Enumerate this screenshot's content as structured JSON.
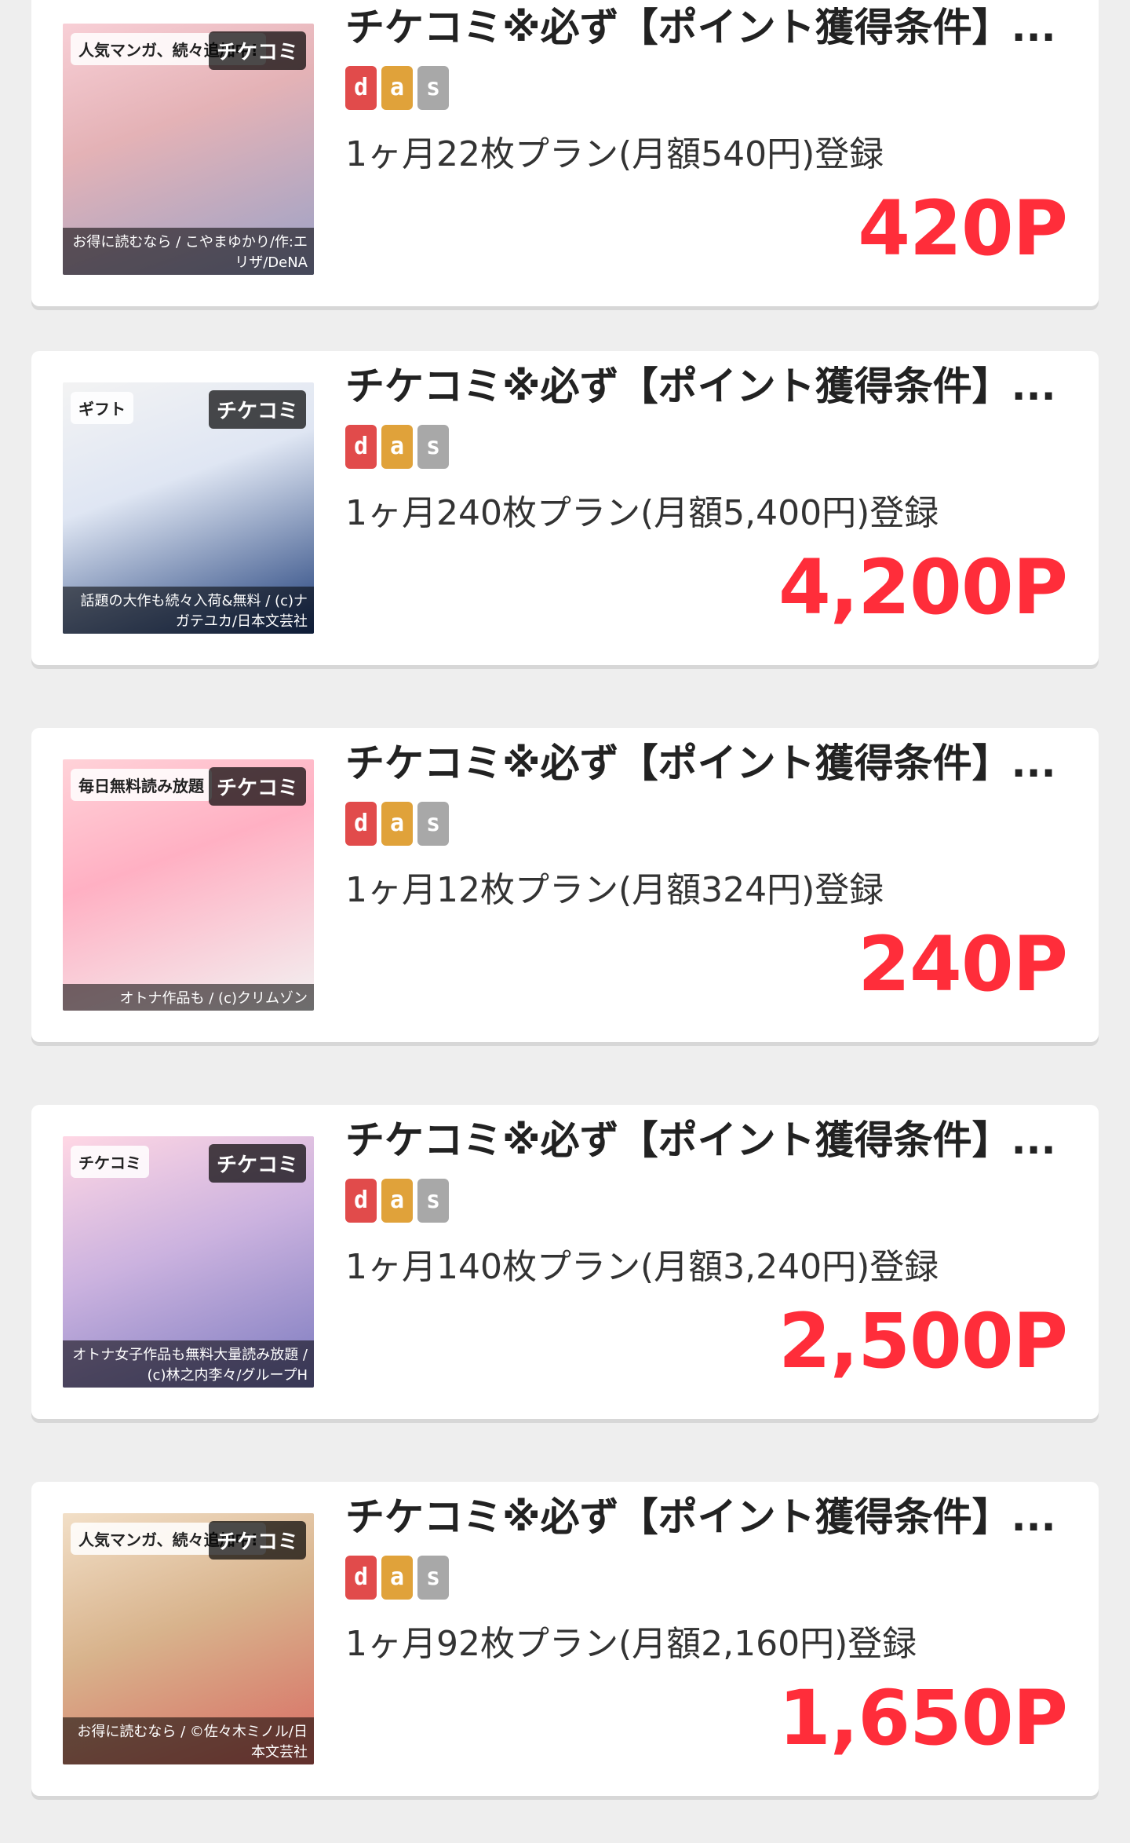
{
  "colors": {
    "badge_d": "#e14b4b",
    "badge_a": "#e0a23a",
    "badge_s": "#a8a8a8",
    "points": "#ff2d3a"
  },
  "offers": [
    {
      "thumb": {
        "top_text": "人気マンガ、続々追加中!",
        "brand": "チケコミ",
        "bottom_text": "お得に読むなら / こやまゆかり/作:エリザ/DeNA"
      },
      "title": "チケコミ※必ず【ポイント獲得条件】...",
      "badges": [
        "d",
        "a",
        "s"
      ],
      "plan": "1ヶ月22枚プラン(月額540円)登録",
      "points": "420P"
    },
    {
      "thumb": {
        "top_text": "ギフト",
        "brand": "チケコミ",
        "bottom_text": "話題の大作も続々入荷&無料 / (c)ナガテユカ/日本文芸社"
      },
      "title": "チケコミ※必ず【ポイント獲得条件】...",
      "badges": [
        "d",
        "a",
        "s"
      ],
      "plan": "1ヶ月240枚プラン(月額5,400円)登録",
      "points": "4,200P"
    },
    {
      "thumb": {
        "top_text": "毎日無料読み放題",
        "brand": "チケコミ",
        "bottom_text": "オトナ作品も / (c)クリムゾン"
      },
      "title": "チケコミ※必ず【ポイント獲得条件】...",
      "badges": [
        "d",
        "a",
        "s"
      ],
      "plan": "1ヶ月12枚プラン(月額324円)登録",
      "points": "240P"
    },
    {
      "thumb": {
        "top_text": "チケコミ",
        "brand": "チケコミ",
        "bottom_text": "オトナ女子作品も無料大量読み放題 / (c)林之内李々/グループH"
      },
      "title": "チケコミ※必ず【ポイント獲得条件】...",
      "badges": [
        "d",
        "a",
        "s"
      ],
      "plan": "1ヶ月140枚プラン(月額3,240円)登録",
      "points": "2,500P"
    },
    {
      "thumb": {
        "top_text": "人気マンガ、続々追加中!",
        "brand": "チケコミ",
        "bottom_text": "お得に読むなら / ©佐々木ミノル/日本文芸社"
      },
      "title": "チケコミ※必ず【ポイント獲得条件】...",
      "badges": [
        "d",
        "a",
        "s"
      ],
      "plan": "1ヶ月92枚プラン(月額2,160円)登録",
      "points": "1,650P"
    }
  ]
}
